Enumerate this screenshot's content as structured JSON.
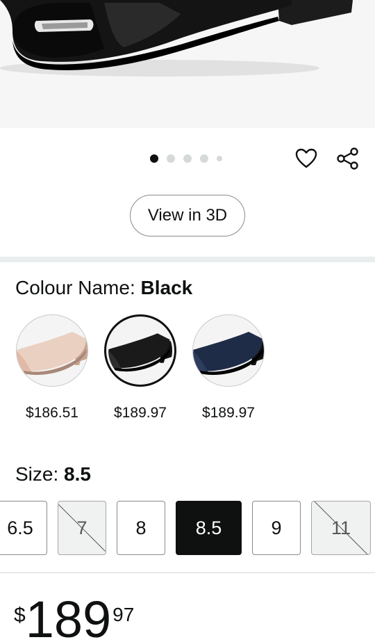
{
  "product_image": {
    "alt": "Black pump shoe"
  },
  "carousel": {
    "total": 5,
    "active_index": 0
  },
  "icons": {
    "wishlist": "heart-icon",
    "share": "share-icon"
  },
  "view_3d": {
    "label": "View in 3D"
  },
  "colour": {
    "label": "Colour Name: ",
    "selected": "Black",
    "swatches": [
      {
        "color_name": "Beige",
        "price": "$186.51",
        "shoe_color": "#e8c9b8",
        "toe_color": "#d8b0a0"
      },
      {
        "color_name": "Black",
        "price": "$189.97",
        "shoe_color": "#151515",
        "toe_color": "#2b2b2b"
      },
      {
        "color_name": "Navy",
        "price": "$189.97",
        "shoe_color": "#1f2c48",
        "toe_color": "#2e3d5e"
      }
    ]
  },
  "size": {
    "label": "Size: ",
    "selected": "8.5",
    "options": [
      {
        "value": "6.5",
        "state": "available"
      },
      {
        "value": "7",
        "state": "unavailable"
      },
      {
        "value": "8",
        "state": "available"
      },
      {
        "value": "8.5",
        "state": "selected"
      },
      {
        "value": "9",
        "state": "available"
      },
      {
        "value": "11",
        "state": "unavailable"
      }
    ]
  },
  "price": {
    "symbol": "$",
    "whole": "189",
    "fraction": "97"
  }
}
